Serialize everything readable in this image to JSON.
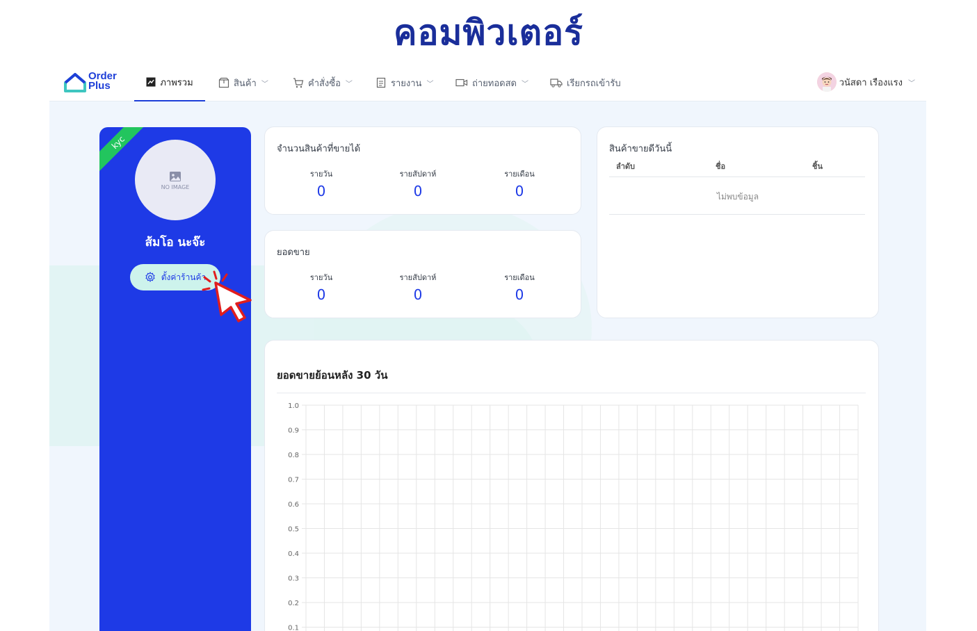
{
  "heading": "คอมพิวเตอร์",
  "logo": {
    "line1": "Order",
    "line2": "Plus"
  },
  "nav": [
    {
      "label": "ภาพรวม",
      "icon": "chart-icon",
      "active": true,
      "dropdown": false
    },
    {
      "label": "สินค้า",
      "icon": "box-icon",
      "dropdown": true
    },
    {
      "label": "คำสั่งซื้อ",
      "icon": "cart-icon",
      "dropdown": true
    },
    {
      "label": "รายงาน",
      "icon": "document-icon",
      "dropdown": true
    },
    {
      "label": "ถ่ายทอดสด",
      "icon": "video-icon",
      "dropdown": true
    },
    {
      "label": "เรียกรถเข้ารับ",
      "icon": "truck-icon",
      "dropdown": false
    }
  ],
  "user": {
    "name": "วนัสดา เรืองแรง"
  },
  "profile": {
    "badge": "kyc",
    "image_placeholder": "NO IMAGE",
    "shop_name": "ส้มโอ นะจ๊ะ",
    "settings_label": "ตั้งค่าร้านค้า"
  },
  "sold_count": {
    "title": "จำนวนสินค้าที่ขายได้",
    "stats": [
      {
        "label": "รายวัน",
        "value": "0"
      },
      {
        "label": "รายสัปดาห์",
        "value": "0"
      },
      {
        "label": "รายเดือน",
        "value": "0"
      }
    ]
  },
  "sales": {
    "title": "ยอดขาย",
    "stats": [
      {
        "label": "รายวัน",
        "value": "0"
      },
      {
        "label": "รายสัปดาห์",
        "value": "0"
      },
      {
        "label": "รายเดือน",
        "value": "0"
      }
    ]
  },
  "best_sellers": {
    "title": "สินค้าขายดีวันนี้",
    "columns": [
      "ลำดับ",
      "ชื่อ",
      "ชิ้น"
    ],
    "empty": "ไม่พบข้อมูล"
  },
  "chart_section": {
    "title": "ยอดขายย้อนหลัง 30 วัน"
  },
  "chart_data": {
    "type": "line",
    "title": "ยอดขายย้อนหลัง 30 วัน",
    "series": [],
    "y_ticks": [
      "1.0",
      "0.9",
      "0.8",
      "0.7",
      "0.6",
      "0.5",
      "0.4",
      "0.3",
      "0.2",
      "0.1"
    ],
    "ylim": [
      0,
      1
    ],
    "grid": true
  },
  "colors": {
    "primary": "#1e3ae6",
    "accent": "#cdf3ec",
    "kyc": "#22c55e",
    "pointer": "#e11d1d"
  }
}
